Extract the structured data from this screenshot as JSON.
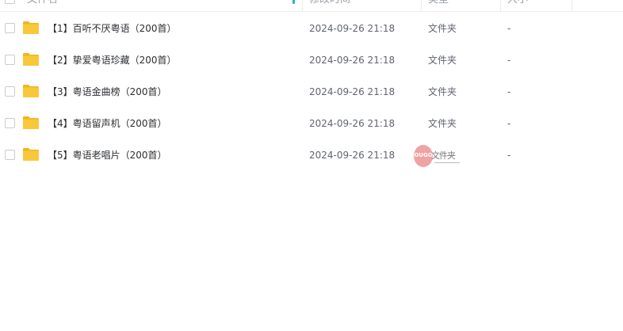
{
  "header": {
    "columns": [
      "文件名",
      "修改时间",
      "类型",
      "大小"
    ]
  },
  "rows": [
    {
      "name": "【1】百听不厌粤语（200首）",
      "mtime": "2024-09-26 21:18",
      "type": "文件夹",
      "size": "-"
    },
    {
      "name": "【2】挚爱粤语珍藏（200首）",
      "mtime": "2024-09-26 21:18",
      "type": "文件夹",
      "size": "-"
    },
    {
      "name": "【3】粤语金曲榜（200首）",
      "mtime": "2024-09-26 21:18",
      "type": "文件夹",
      "size": "-"
    },
    {
      "name": "【4】粤语留声机（200首）",
      "mtime": "2024-09-26 21:18",
      "type": "文件夹",
      "size": "-"
    },
    {
      "name": "【5】粤语老唱片（200首）",
      "mtime": "2024-09-26 21:18",
      "type": "文件夹",
      "size": "-"
    }
  ],
  "watermark": {
    "logo": "OUGO",
    "text": "文件夹"
  },
  "colors": {
    "folder": "#f9c83a",
    "folder_dark": "#f1b51e",
    "sort_accent": "#2bb5b0",
    "text_primary": "#2d2f33",
    "text_secondary": "#60656d"
  },
  "icons": {
    "row_icon": "folder-icon",
    "sort_indicator": "sort-indicator-icon"
  }
}
